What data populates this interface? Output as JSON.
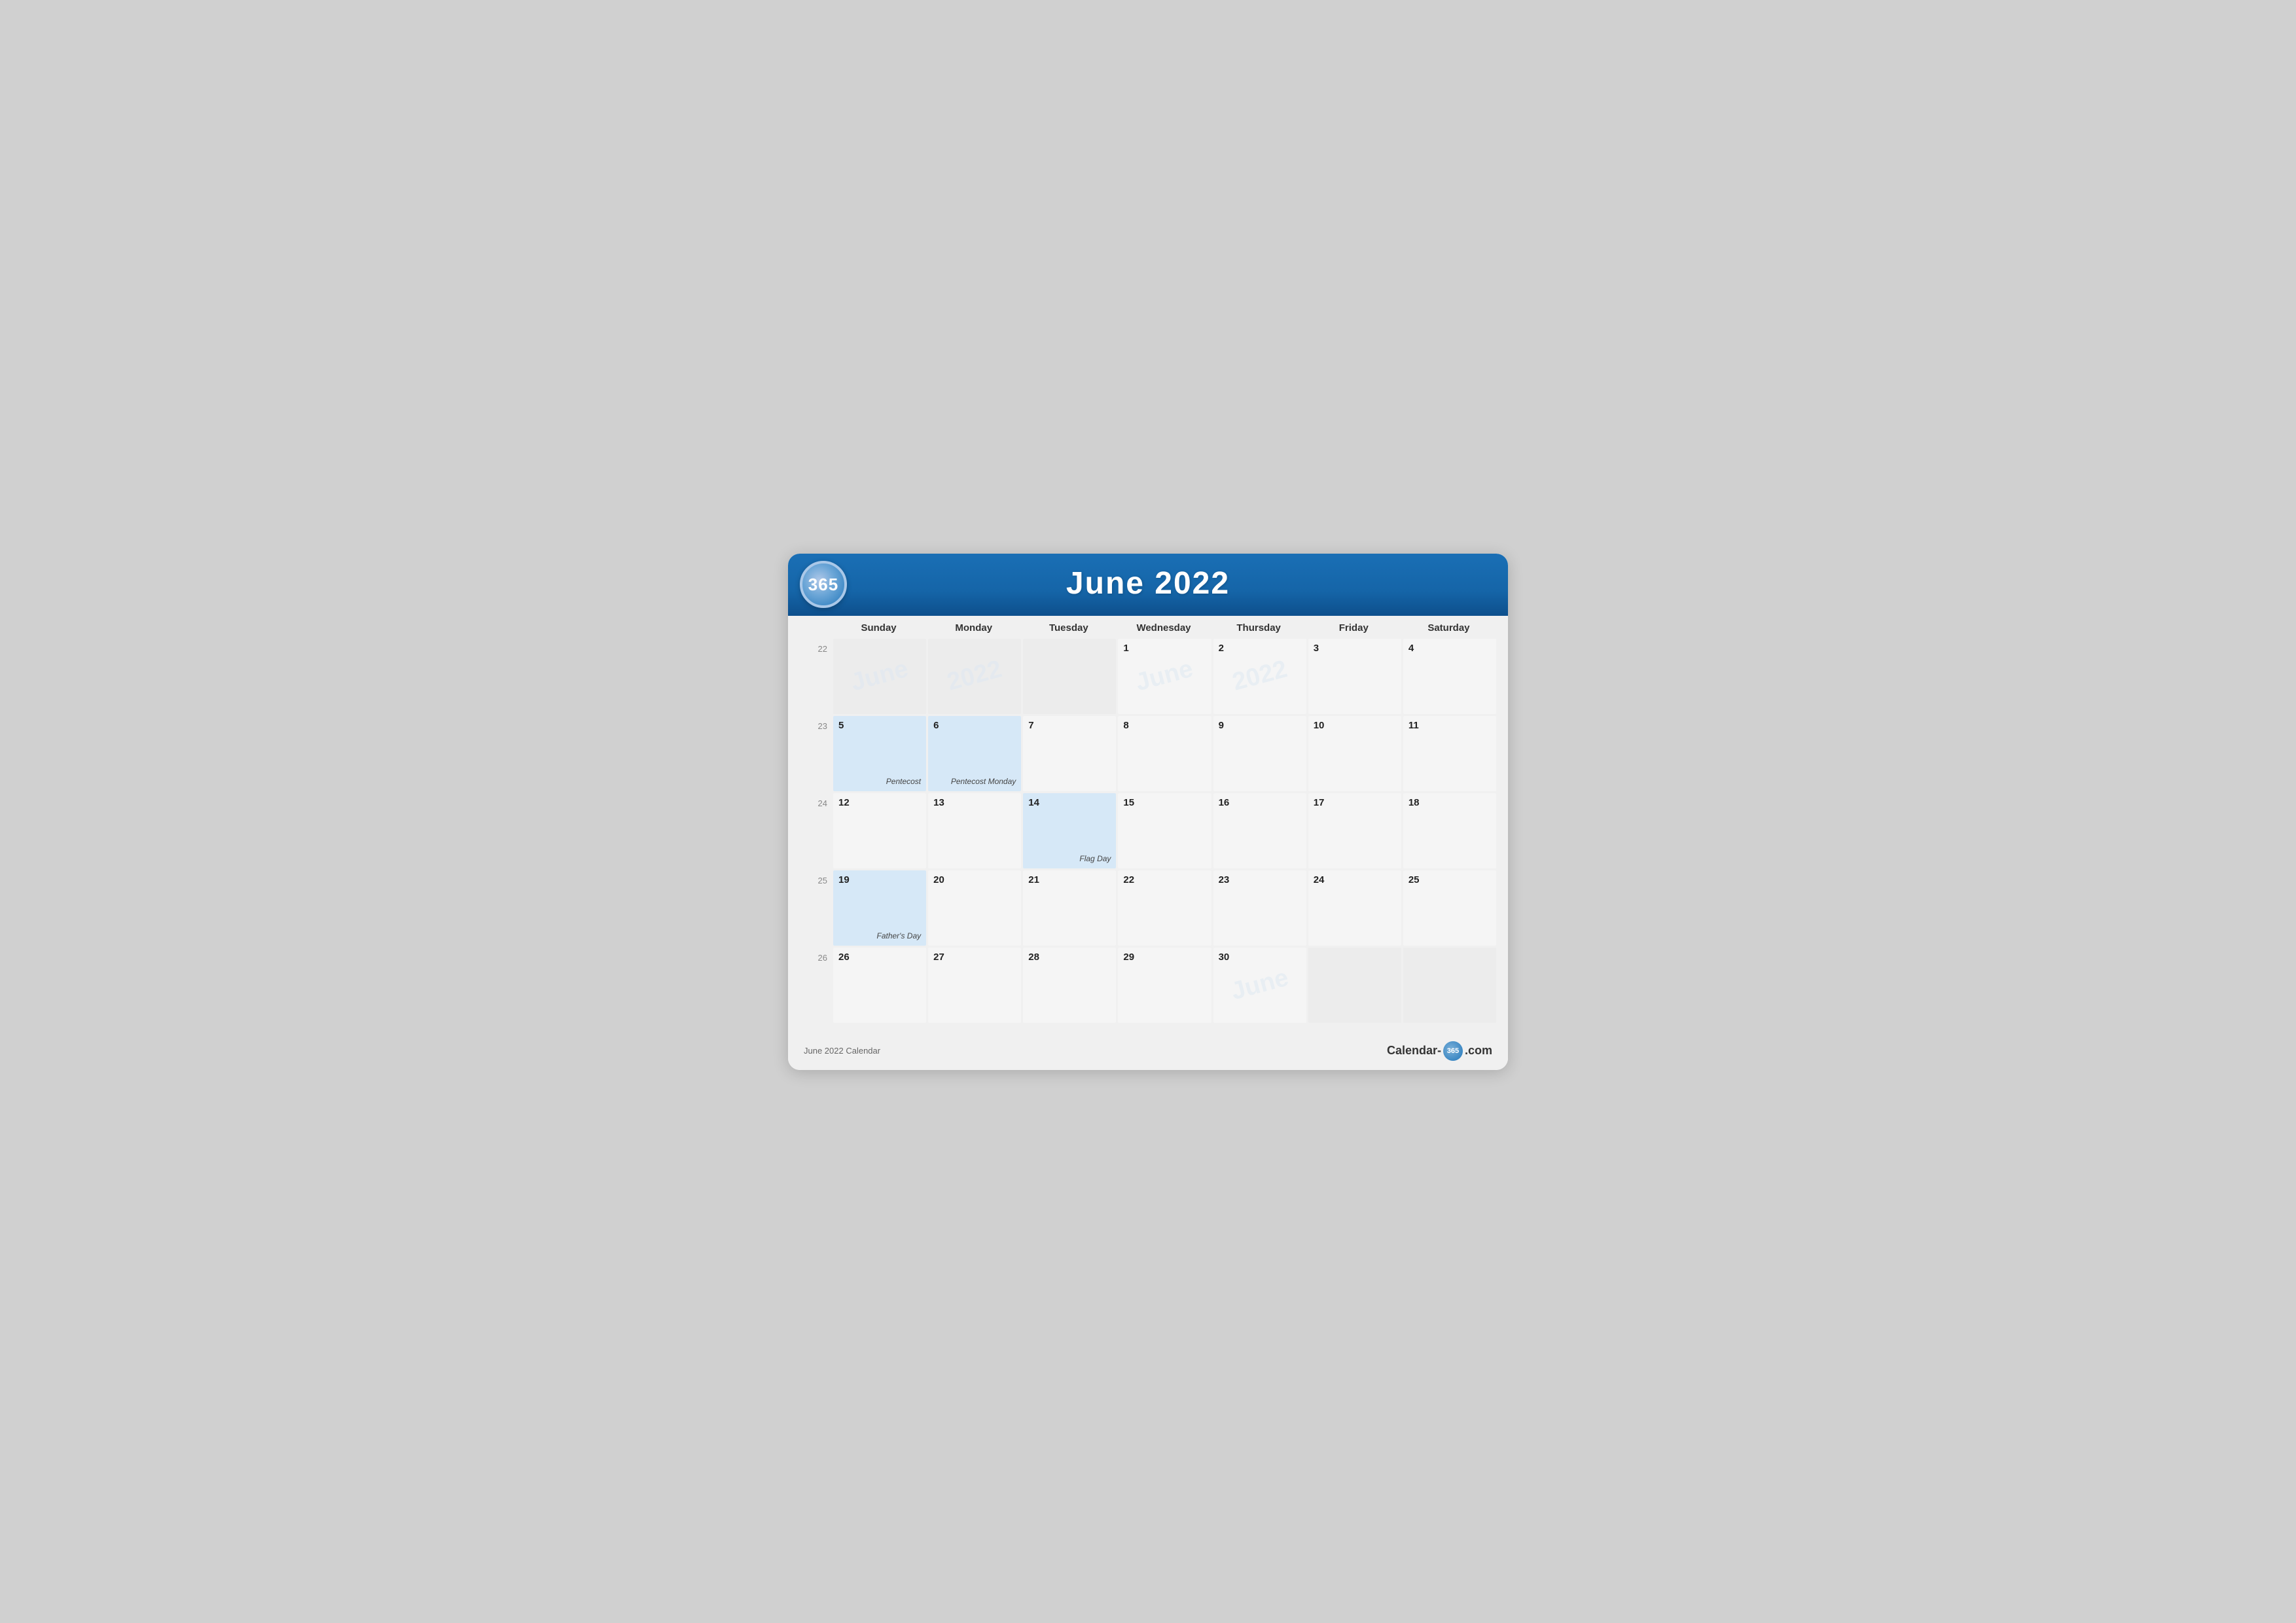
{
  "header": {
    "logo": "365",
    "title": "June 2022"
  },
  "day_headers": [
    "Sunday",
    "Monday",
    "Tuesday",
    "Wednesday",
    "Thursday",
    "Friday",
    "Saturday"
  ],
  "weeks": [
    {
      "week_num": "22",
      "days": [
        {
          "date": "",
          "style": "empty",
          "event": ""
        },
        {
          "date": "",
          "style": "empty",
          "event": ""
        },
        {
          "date": "",
          "style": "empty",
          "event": ""
        },
        {
          "date": "1",
          "style": "white-bg",
          "event": ""
        },
        {
          "date": "2",
          "style": "white-bg",
          "event": ""
        },
        {
          "date": "3",
          "style": "white-bg",
          "event": ""
        },
        {
          "date": "4",
          "style": "white-bg",
          "event": ""
        }
      ]
    },
    {
      "week_num": "23",
      "days": [
        {
          "date": "5",
          "style": "highlight",
          "event": "Pentecost"
        },
        {
          "date": "6",
          "style": "highlight",
          "event": "Pentecost Monday"
        },
        {
          "date": "7",
          "style": "white-bg",
          "event": ""
        },
        {
          "date": "8",
          "style": "white-bg",
          "event": ""
        },
        {
          "date": "9",
          "style": "white-bg",
          "event": ""
        },
        {
          "date": "10",
          "style": "white-bg",
          "event": ""
        },
        {
          "date": "11",
          "style": "white-bg",
          "event": ""
        }
      ]
    },
    {
      "week_num": "24",
      "days": [
        {
          "date": "12",
          "style": "white-bg",
          "event": ""
        },
        {
          "date": "13",
          "style": "white-bg",
          "event": ""
        },
        {
          "date": "14",
          "style": "highlight",
          "event": "Flag Day"
        },
        {
          "date": "15",
          "style": "white-bg",
          "event": ""
        },
        {
          "date": "16",
          "style": "white-bg",
          "event": ""
        },
        {
          "date": "17",
          "style": "white-bg",
          "event": ""
        },
        {
          "date": "18",
          "style": "white-bg",
          "event": ""
        }
      ]
    },
    {
      "week_num": "25",
      "days": [
        {
          "date": "19",
          "style": "highlight",
          "event": "Father's Day"
        },
        {
          "date": "20",
          "style": "white-bg",
          "event": ""
        },
        {
          "date": "21",
          "style": "white-bg",
          "event": ""
        },
        {
          "date": "22",
          "style": "white-bg",
          "event": ""
        },
        {
          "date": "23",
          "style": "white-bg",
          "event": ""
        },
        {
          "date": "24",
          "style": "white-bg",
          "event": ""
        },
        {
          "date": "25",
          "style": "white-bg",
          "event": ""
        }
      ]
    },
    {
      "week_num": "26",
      "days": [
        {
          "date": "26",
          "style": "white-bg",
          "event": ""
        },
        {
          "date": "27",
          "style": "white-bg",
          "event": ""
        },
        {
          "date": "28",
          "style": "white-bg",
          "event": ""
        },
        {
          "date": "29",
          "style": "white-bg",
          "event": ""
        },
        {
          "date": "30",
          "style": "white-bg",
          "event": ""
        },
        {
          "date": "",
          "style": "empty",
          "event": ""
        },
        {
          "date": "",
          "style": "empty",
          "event": ""
        }
      ]
    }
  ],
  "footer": {
    "left": "June 2022 Calendar",
    "right_prefix": "Calendar-",
    "badge": "365",
    "right_suffix": ".com"
  },
  "watermarks": {
    "june": "June",
    "2022": "2022"
  }
}
